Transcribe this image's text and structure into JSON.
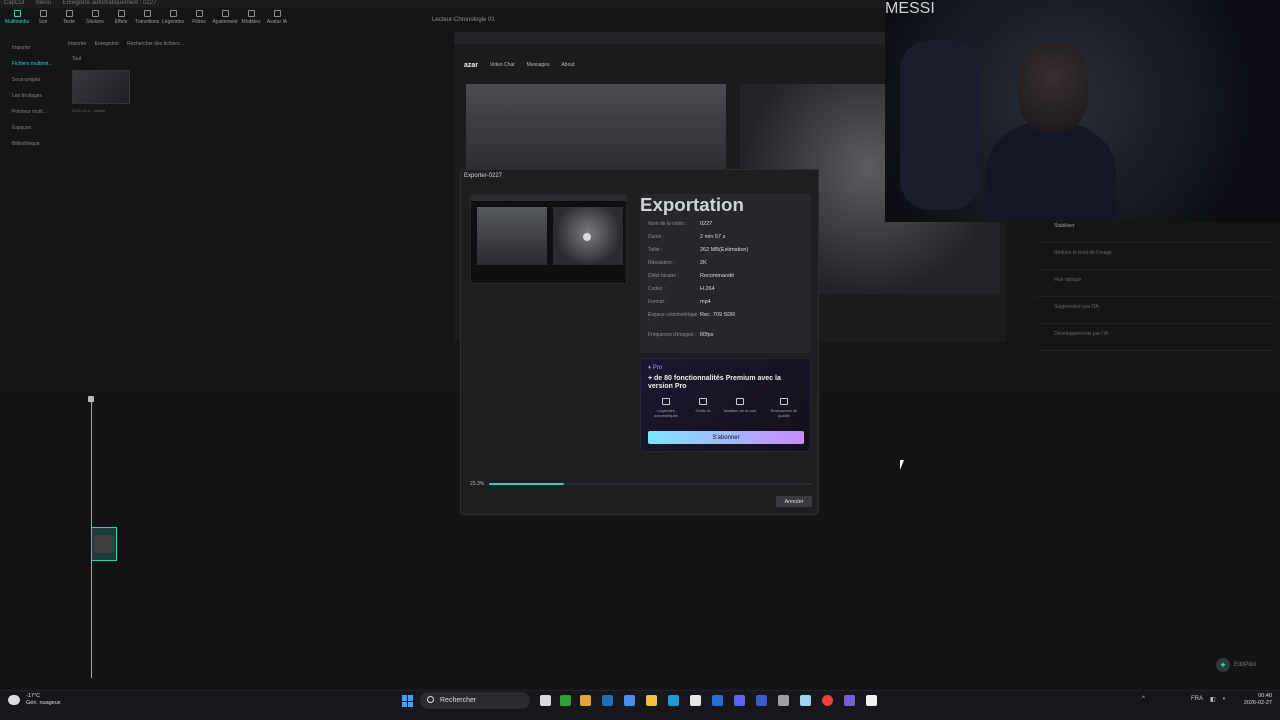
{
  "titlebar": {
    "app": "CapCut",
    "menu": "Menu",
    "project": "Enregistré automatiquement : 0227"
  },
  "toolbar": {
    "items": [
      "Multimédia",
      "Son",
      "Texte",
      "Stickers",
      "Effets",
      "Transitions",
      "Légendes",
      "Filtres",
      "Ajustement",
      "Modèles",
      "Avatar IA"
    ]
  },
  "sidebar": {
    "items": [
      "Importer",
      "Fichiers multimé...",
      "Sous-projets",
      "Les bruitages",
      "Pointeur multi...",
      "Espaces",
      "Bibliothèque"
    ]
  },
  "media": {
    "import": "Importer",
    "record": "Enregistrer",
    "search_placeholder": "Rechercher des fichiers...",
    "section": "Tout",
    "clip_caption": "2026-02-2...intitulé"
  },
  "player": {
    "title": "Lecteur-Chronologie 01"
  },
  "azar": {
    "logo": "azar",
    "nav": [
      "Video Chat",
      "Messages",
      "About"
    ]
  },
  "right_panel": {
    "items": [
      "Stabiliser",
      "Réduire le bruit de l'image",
      "Flux optique",
      "Suppression par l'IA",
      "Développements par l'IA"
    ]
  },
  "dialog": {
    "title": "Exporter-0227",
    "heading": "Exportation",
    "fields": [
      {
        "label": "Nom de la vidéo :",
        "value": "0227"
      },
      {
        "label": "Durée :",
        "value": "2 min 57 s"
      },
      {
        "label": "Taille :",
        "value": "262 MB(Estimation)"
      },
      {
        "label": "Résolution :",
        "value": "2K"
      },
      {
        "label": "Débit binaire :",
        "value": "Recommandé"
      },
      {
        "label": "Codec :",
        "value": "H.264"
      },
      {
        "label": "Format :",
        "value": "mp4"
      },
      {
        "label": "Espace colorimétrique :",
        "value": "Rec. 709 SDR"
      },
      {
        "label": "Fréquence d'images :",
        "value": "60fps"
      }
    ],
    "pro": {
      "tag": "Pro",
      "text": "+ de 80 fonctionnalités Premium avec la version Pro",
      "features": [
        "Légendes automatiques",
        "Outils IA",
        "Isolation de la voix",
        "Ressources de qualité"
      ],
      "subscribe": "S'abonner"
    },
    "progress": {
      "label": "23.3%",
      "fraction": 0.233
    },
    "cancel": "Annuler"
  },
  "editpilot": "EditPilot",
  "webcam": {
    "jersey": "MESSI"
  },
  "taskbar": {
    "weather_temp": "-17°C",
    "weather_desc": "Gén. nuageux",
    "search": "Rechercher",
    "lang": "FRA",
    "time": "00:40",
    "date": "2026-02-27"
  },
  "colors": {
    "accent": "#2ed0b8",
    "pro": "#b38cff"
  }
}
